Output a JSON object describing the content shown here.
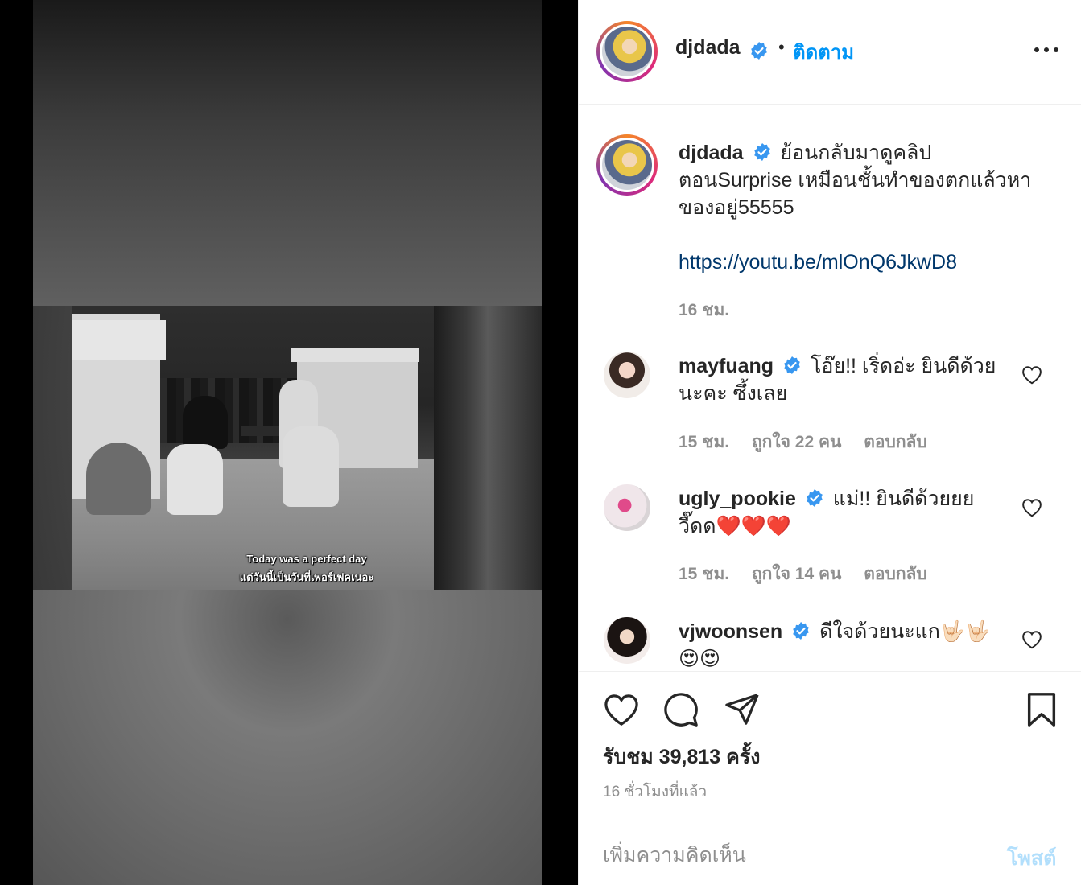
{
  "post": {
    "author": "djdada",
    "follow_label": "ติดตาม",
    "separator": "•",
    "caption_lines": [
      "ย้อนกลับมาดูคลิป",
      "ตอนSurprise เหมือนชั้นทำของตกแล้วหา",
      "ของอยู่55555"
    ],
    "caption_link": "https://youtu.be/mlOnQ6JkwD8",
    "caption_time": "16 ชม."
  },
  "video": {
    "subtitle_line1": "Today was a perfect day",
    "subtitle_line2": "แต่วันนี้เป็นวันที่เพอร์เฟคเนอะ"
  },
  "comments": [
    {
      "username": "mayfuang",
      "text_line1": "โอ๊ย!! เริ่ดอ่ะ ยินดีด้วย",
      "text_line2": "นะคะ ซึ้งเลย",
      "time": "15 ชม.",
      "likes": "ถูกใจ 22 คน",
      "reply": "ตอบกลับ"
    },
    {
      "username": "ugly_pookie",
      "text_line1": "แม่!! ยินดีด้วยยย",
      "text_line2": "วี๊ดด❤️❤️❤️",
      "time": "15 ชม.",
      "likes": "ถูกใจ 14 คน",
      "reply": "ตอบกลับ"
    },
    {
      "username": "vjwoonsen",
      "text_line1": "ดีใจด้วยนะแก🤟🏻🤟🏻",
      "text_line2": "😍😍"
    }
  ],
  "stats": {
    "views": "รับชม 39,813 ครั้ง",
    "timestamp": "16 ชั่วโมงที่แล้ว"
  },
  "composer": {
    "placeholder": "เพิ่มความคิดเห็น",
    "post_label": "โพสต์"
  },
  "colors": {
    "accent": "#0095f6",
    "verified": "#3897f0",
    "link": "#00376b",
    "muted": "#8e8e8e",
    "post_disabled": "#b2dffc"
  },
  "icons": [
    "verified-badge-icon",
    "more-options-icon",
    "heart-icon",
    "comment-icon",
    "share-icon",
    "bookmark-icon"
  ]
}
